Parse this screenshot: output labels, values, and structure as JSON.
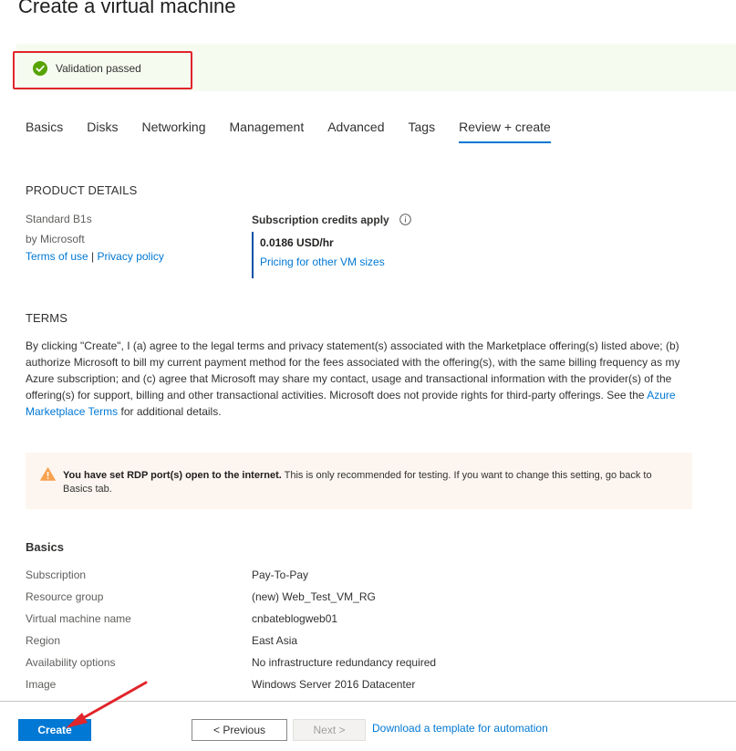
{
  "page": {
    "title": "Create a virtual machine"
  },
  "validation": {
    "text": "Validation passed"
  },
  "tabs": [
    {
      "label": "Basics"
    },
    {
      "label": "Disks"
    },
    {
      "label": "Networking"
    },
    {
      "label": "Management"
    },
    {
      "label": "Advanced"
    },
    {
      "label": "Tags"
    },
    {
      "label": "Review + create",
      "active": true
    }
  ],
  "product": {
    "heading": "PRODUCT DETAILS",
    "name": "Standard B1s",
    "publisher": "by Microsoft",
    "terms_link": "Terms of use",
    "separator": "|",
    "privacy_link": "Privacy policy",
    "credits_label": "Subscription credits apply",
    "price": "0.0186 USD/hr",
    "pricing_link": "Pricing for other VM sizes"
  },
  "terms": {
    "heading": "TERMS",
    "text_before": "By clicking \"Create\", I (a) agree to the legal terms and privacy statement(s) associated with the Marketplace offering(s) listed above; (b) authorize Microsoft to bill my current payment method for the fees associated with the offering(s), with the same billing frequency as my Azure subscription; and (c) agree that Microsoft may share my contact, usage and transactional information with the provider(s) of the offering(s) for support, billing and other transactional activities. Microsoft does not provide rights for third-party offerings. See the ",
    "link": "Azure Marketplace Terms",
    "text_after": " for additional details."
  },
  "warning": {
    "bold": "You have set RDP port(s) open to the internet.",
    "text": "  This is only recommended for testing.  If you want to change this setting, go back to Basics tab."
  },
  "basics": {
    "heading": "Basics",
    "rows": [
      {
        "label": "Subscription",
        "value": "Pay-To-Pay"
      },
      {
        "label": "Resource group",
        "value": "(new) Web_Test_VM_RG"
      },
      {
        "label": "Virtual machine name",
        "value": "cnbateblogweb01"
      },
      {
        "label": "Region",
        "value": "East Asia"
      },
      {
        "label": "Availability options",
        "value": "No infrastructure redundancy required"
      },
      {
        "label": "Image",
        "value": "Windows Server 2016 Datacenter"
      }
    ]
  },
  "footer": {
    "create_label": "Create",
    "previous_label": "< Previous",
    "next_label": "Next >",
    "download_link": "Download a template for automation"
  },
  "colors": {
    "accent": "#0078d4",
    "success": "#57a300",
    "warning": "#f7a24f",
    "annotation": "#e0252b"
  },
  "icons": {
    "validation": "check-circle-icon",
    "credits_info": "info-icon",
    "warning": "warning-triangle-icon"
  }
}
